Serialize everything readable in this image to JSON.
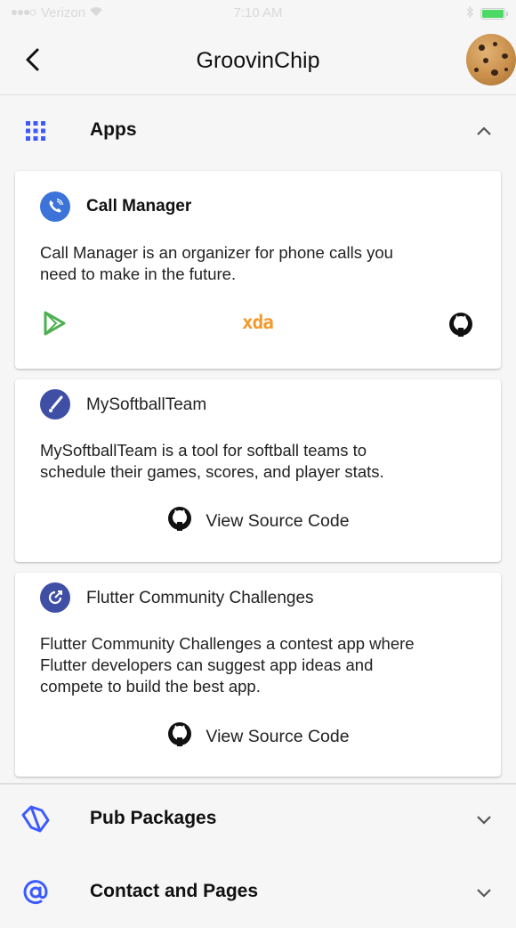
{
  "status_bar": {
    "carrier": "Verizon",
    "time": "7:10 AM"
  },
  "app_bar": {
    "title": "GroovinChip",
    "back_icon": "back-arrow-icon",
    "avatar": "cookie-avatar"
  },
  "sections": {
    "apps": {
      "label": "Apps",
      "icon": "grid-icon",
      "expanded": true
    },
    "pub_packages": {
      "label": "Pub Packages",
      "icon": "dart-icon",
      "expanded": false
    },
    "contact": {
      "label": "Contact and Pages",
      "icon": "at-icon",
      "expanded": false
    }
  },
  "apps": [
    {
      "name": "Call Manager",
      "description_lines": [
        "Call Manager is an organizer for phone calls you",
        "need to make in the future."
      ],
      "links": [
        "play-store-icon",
        "xda-icon",
        "github-icon"
      ],
      "xda_label": "xda"
    },
    {
      "name": "MySoftballTeam",
      "description_lines": [
        "MySoftballTeam is a tool for softball teams to",
        "schedule their games, scores, and player stats."
      ],
      "button_label": "View Source Code"
    },
    {
      "name": "Flutter Community Challenges",
      "description_lines": [
        "Flutter Community Challenges a contest app where",
        "Flutter developers can suggest app ideas and",
        "compete to build the best app."
      ],
      "button_label": "View Source Code"
    }
  ],
  "colors": {
    "accent": "#3d5afe",
    "icon_blue": "#3b73d8",
    "icon_indigo": "#3f4fa6",
    "play_green": "#4caf50",
    "xda_orange": "#f29a2e"
  }
}
